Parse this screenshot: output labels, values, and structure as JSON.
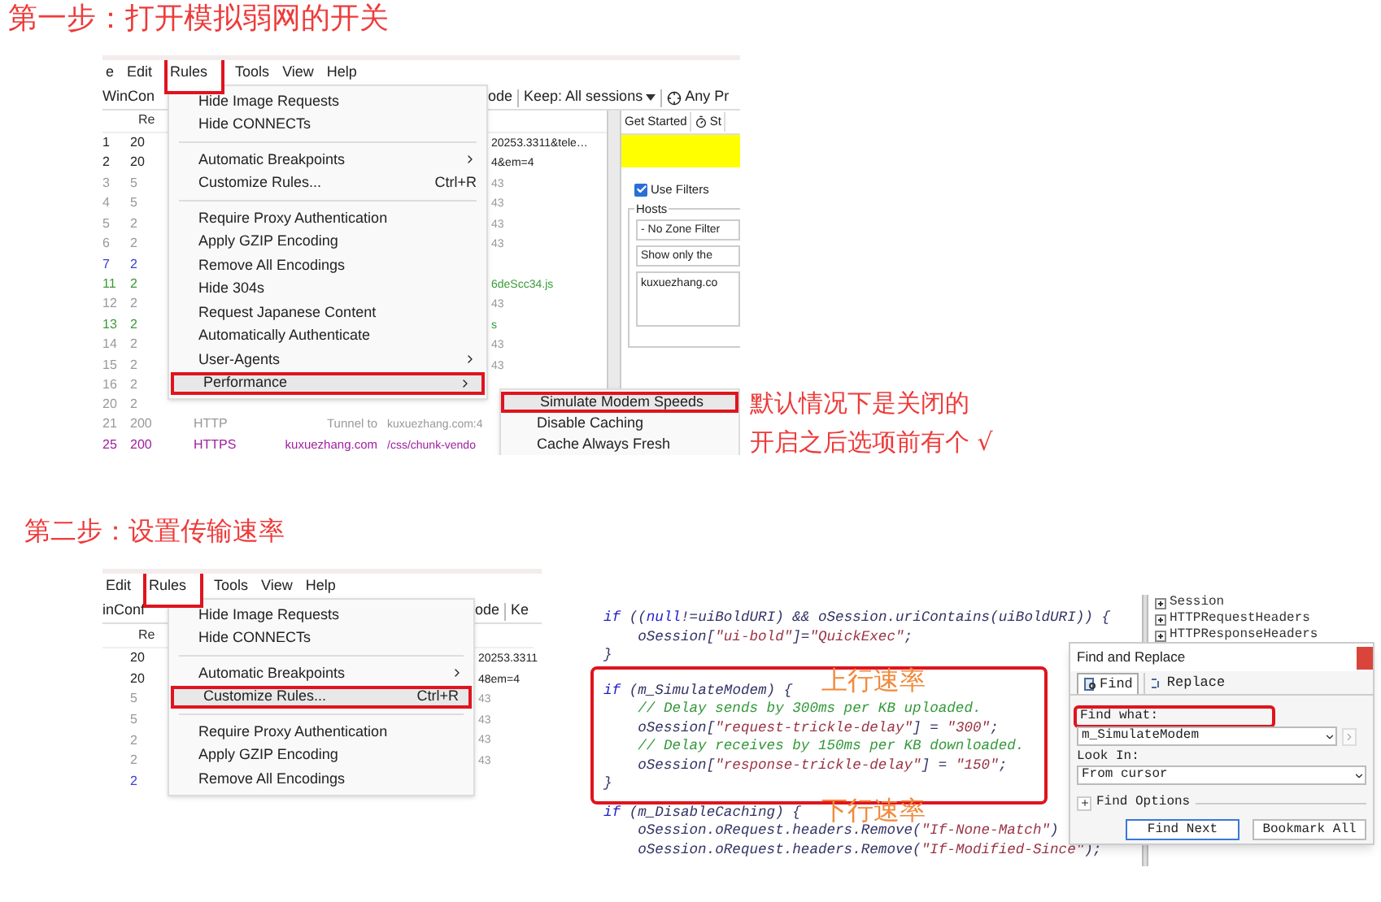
{
  "step1": {
    "title": "第一步：打开模拟弱网的开关",
    "screenshot": {
      "menubar": [
        {
          "label": "e",
          "highlighted": false
        },
        {
          "label": "Edit",
          "highlighted": false
        },
        {
          "label": "Rules",
          "highlighted": true
        },
        {
          "label": "Tools",
          "highlighted": false
        },
        {
          "label": "View",
          "highlighted": false
        },
        {
          "label": "Help",
          "highlighted": false
        }
      ],
      "toolbar": [
        {
          "text": "WinCon",
          "kind": "text"
        },
        {
          "text": "ode",
          "kind": "text"
        },
        {
          "text": "Keep: All sessions",
          "kind": "dropdown"
        },
        {
          "text": "Any Pr",
          "kind": "target"
        }
      ],
      "column_header": "Re",
      "sessions": [
        {
          "num": "1",
          "result": "20",
          "url": "20253.3311&tele…",
          "color": "#222222"
        },
        {
          "num": "2",
          "result": "20",
          "url": "4&em=4",
          "color": "#222222"
        },
        {
          "num": "3",
          "result": "5",
          "url": "43",
          "color": "#999999"
        },
        {
          "num": "4",
          "result": "5",
          "url": "43",
          "color": "#999999"
        },
        {
          "num": "5",
          "result": "2",
          "url": "43",
          "color": "#999999"
        },
        {
          "num": "6",
          "result": "2",
          "url": "43",
          "color": "#999999"
        },
        {
          "num": "7",
          "result": "2",
          "color": "#3b3bdf"
        },
        {
          "num": "11",
          "result": "2",
          "url": "6deScc34.js",
          "color": "#3a9a3a"
        },
        {
          "num": "12",
          "result": "2",
          "url": "43",
          "color": "#999999"
        },
        {
          "num": "13",
          "result": "2",
          "url": "s",
          "color": "#3a9a3a"
        },
        {
          "num": "14",
          "result": "2",
          "url": "43",
          "color": "#999999"
        },
        {
          "num": "15",
          "result": "2",
          "url": "43",
          "color": "#999999"
        },
        {
          "num": "16",
          "result": "2",
          "color": "#999999"
        },
        {
          "num": "20",
          "result": "2",
          "color": "#999999"
        },
        {
          "num": "21",
          "result": "200",
          "protocol": "HTTP",
          "host": "Tunnel to",
          "url": "kuxuezhang.com:4",
          "color": "#999999"
        },
        {
          "num": "25",
          "result": "200",
          "protocol": "HTTPS",
          "host": "kuxuezhang.com",
          "url": "/css/chunk-vendo",
          "color": "#a020a0"
        }
      ],
      "menu": [
        {
          "kind": "item",
          "label": "Hide Image Requests",
          "highlighted": false
        },
        {
          "kind": "item",
          "label": "Hide CONNECTs",
          "highlighted": false
        },
        {
          "kind": "separator"
        },
        {
          "kind": "item",
          "label": "Automatic Breakpoints",
          "submenu": true,
          "highlighted": false
        },
        {
          "kind": "item",
          "label": "Customize Rules...",
          "shortcut": "Ctrl+R",
          "highlighted": false
        },
        {
          "kind": "separator"
        },
        {
          "kind": "item",
          "label": "Require Proxy Authentication",
          "highlighted": false
        },
        {
          "kind": "item",
          "label": "Apply GZIP Encoding",
          "highlighted": false
        },
        {
          "kind": "item",
          "label": "Remove All Encodings",
          "highlighted": false
        },
        {
          "kind": "item",
          "label": "Hide 304s",
          "highlighted": false
        },
        {
          "kind": "item",
          "label": "Request Japanese Content",
          "highlighted": false
        },
        {
          "kind": "item",
          "label": "Automatically Authenticate",
          "highlighted": false
        },
        {
          "kind": "item",
          "label": "User-Agents",
          "submenu": true,
          "highlighted": false
        },
        {
          "kind": "item",
          "label": "Performance",
          "submenu": true,
          "highlighted": true
        }
      ],
      "submenu": [
        {
          "label": "Simulate Modem Speeds",
          "highlighted": true
        },
        {
          "label": "Disable Caching",
          "highlighted": false
        },
        {
          "label": "Cache Always Fresh",
          "highlighted": false
        }
      ],
      "side_panel": {
        "tabs": [
          "Get Started",
          "St"
        ],
        "use_filters": {
          "label": "Use Filters",
          "checked": true
        },
        "hosts": {
          "label": "Hosts",
          "fields": [
            "- No Zone Filter",
            "Show only the"
          ],
          "textarea": "kuxuezhang.co"
        }
      }
    },
    "notes": [
      "默认情况下是关闭的",
      "开启之后选项前有个 √"
    ]
  },
  "step2": {
    "title": "第二步：设置传输速率",
    "screenshot": {
      "menubar": [
        {
          "label": "Edit",
          "highlighted": false
        },
        {
          "label": "Rules",
          "highlighted": true
        },
        {
          "label": "Tools",
          "highlighted": false
        },
        {
          "label": "View",
          "highlighted": false
        },
        {
          "label": "Help",
          "highlighted": false
        }
      ],
      "toolbar": [
        {
          "text": "inConf",
          "kind": "text"
        },
        {
          "text": "ode",
          "kind": "text"
        },
        {
          "text": "Ke",
          "kind": "text"
        }
      ],
      "column_header": "Re",
      "sessions": [
        {
          "result": "20",
          "url": "20253.3311",
          "color": "#222222"
        },
        {
          "result": "20",
          "url": "48em=4",
          "color": "#222222"
        },
        {
          "result": "5",
          "url": "43",
          "color": "#999999"
        },
        {
          "result": "5",
          "url": "43",
          "color": "#999999"
        },
        {
          "result": "2",
          "url": "43",
          "color": "#999999"
        },
        {
          "result": "2",
          "url": "43",
          "color": "#999999"
        },
        {
          "result": "2",
          "color": "#3b3bdf"
        }
      ],
      "menu": [
        {
          "kind": "item",
          "label": "Hide Image Requests",
          "highlighted": false
        },
        {
          "kind": "item",
          "label": "Hide CONNECTs",
          "highlighted": false
        },
        {
          "kind": "separator"
        },
        {
          "kind": "item",
          "label": "Automatic Breakpoints",
          "submenu": true,
          "highlighted": false
        },
        {
          "kind": "item",
          "label": "Customize Rules...",
          "shortcut": "Ctrl+R",
          "highlighted": true
        },
        {
          "kind": "separator"
        },
        {
          "kind": "item",
          "label": "Require Proxy Authentication",
          "highlighted": false
        },
        {
          "kind": "item",
          "label": "Apply GZIP Encoding",
          "highlighted": false
        },
        {
          "kind": "item",
          "label": "Remove All Encodings",
          "highlighted": false
        }
      ]
    },
    "editor": {
      "code_before": [
        {
          "segments": [
            {
              "kind": "kw",
              "t": "if"
            },
            {
              "kind": "id",
              "t": " (("
            },
            {
              "kind": "kw",
              "t": "null"
            },
            {
              "kind": "id",
              "t": "!=uiBoldURI) && oSession.uriContains(uiBoldURI)) {"
            }
          ]
        },
        {
          "indent": true,
          "segments": [
            {
              "kind": "id",
              "t": "oSession["
            },
            {
              "kind": "str",
              "t": "\"ui-bold\""
            },
            {
              "kind": "id",
              "t": "]="
            },
            {
              "kind": "str",
              "t": "\"QuickExec\""
            },
            {
              "kind": "id",
              "t": ";"
            }
          ]
        },
        {
          "segments": [
            {
              "kind": "id",
              "t": "}"
            }
          ]
        }
      ],
      "code_highlighted": [
        {
          "segments": [
            {
              "kind": "kw",
              "t": "if"
            },
            {
              "kind": "id",
              "t": " (m_SimulateModem) {"
            }
          ]
        },
        {
          "indent": true,
          "segments": [
            {
              "kind": "cm",
              "t": "// Delay sends by 300ms per KB uploaded."
            }
          ]
        },
        {
          "indent": true,
          "segments": [
            {
              "kind": "id",
              "t": "oSession["
            },
            {
              "kind": "str",
              "t": "\"request-trickle-delay\""
            },
            {
              "kind": "id",
              "t": "] = "
            },
            {
              "kind": "str",
              "t": "\"300\""
            },
            {
              "kind": "id",
              "t": ";"
            }
          ]
        },
        {
          "indent": true,
          "segments": [
            {
              "kind": "cm",
              "t": "// Delay receives by 150ms per KB downloaded."
            }
          ]
        },
        {
          "indent": true,
          "segments": [
            {
              "kind": "id",
              "t": "oSession["
            },
            {
              "kind": "str",
              "t": "\"response-trickle-delay\""
            },
            {
              "kind": "id",
              "t": "] = "
            },
            {
              "kind": "str",
              "t": "\"150\""
            },
            {
              "kind": "id",
              "t": ";"
            }
          ]
        },
        {
          "segments": [
            {
              "kind": "id",
              "t": "}"
            }
          ]
        }
      ],
      "code_after": [
        {
          "segments": [
            {
              "kind": "kw",
              "t": "if"
            },
            {
              "kind": "id",
              "t": " (m_DisableCaching) {"
            }
          ]
        },
        {
          "indent": true,
          "segments": [
            {
              "kind": "id",
              "t": "oSession.oRequest.headers.Remove("
            },
            {
              "kind": "str",
              "t": "\"If-None-Match\""
            },
            {
              "kind": "id",
              "t": ")"
            }
          ]
        },
        {
          "indent": true,
          "segments": [
            {
              "kind": "id",
              "t": "oSession.oRequest.headers.Remove("
            },
            {
              "kind": "str",
              "t": "\"If-Modified-Since\""
            },
            {
              "kind": "id",
              "t": ");"
            }
          ]
        }
      ],
      "annotations": [
        "上行速率",
        "下行速率"
      ],
      "tree": [
        "Session",
        "HTTPRequestHeaders",
        "HTTPResponseHeaders"
      ],
      "dialog": {
        "title": "Find and Replace",
        "tabs": [
          {
            "label": "Find",
            "selected": true
          },
          {
            "label": "Replace",
            "selected": false
          }
        ],
        "find_what": {
          "label": "Find what:",
          "value": "m_SimulateModem",
          "highlighted": true
        },
        "look_in": {
          "label": "Look In:",
          "value": "From cursor"
        },
        "options": "Find Options",
        "buttons": [
          {
            "label": "Find Next",
            "default": true
          },
          {
            "label": "Bookmark All",
            "default": false
          }
        ]
      }
    }
  }
}
